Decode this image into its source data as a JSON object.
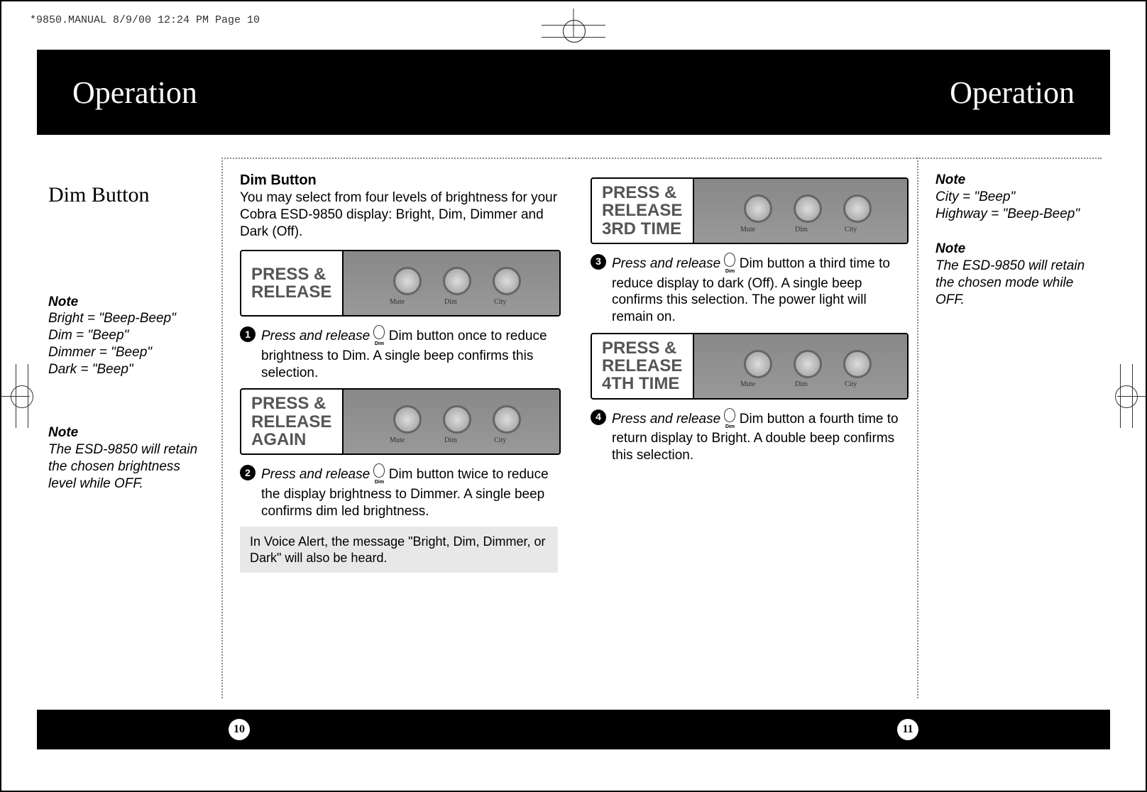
{
  "header_line": "*9850.MANUAL  8/9/00  12:24 PM  Page 10",
  "band_left": "Operation",
  "band_right": "Operation",
  "subtitle": "Dim Button",
  "left_notes": {
    "n1_label": "Note",
    "n1_l1": "Bright = \"Beep-Beep\"",
    "n1_l2": "Dim = \"Beep\"",
    "n1_l3": "Dimmer = \"Beep\"",
    "n1_l4": "Dark = \"Beep\"",
    "n2_label": "Note",
    "n2_body": "The ESD-9850 will retain the chosen brightness level while OFF."
  },
  "main": {
    "heading": "Dim Button",
    "intro": "You may select from four levels of brightness for your Cobra ESD-9850 display:  Bright, Dim, Dimmer and Dark (Off).",
    "fig1": "PRESS & RELEASE",
    "step1_em": "Press and release",
    "step1_rest": "Dim button once to reduce brightness to Dim. A single beep confirms this selection.",
    "fig2": "PRESS & RELEASE AGAIN",
    "step2_em": "Press and release",
    "step2_rest": "Dim button twice to reduce the display brightness to Dimmer. A single beep confirms dim led brightness.",
    "voice_box": "In Voice Alert, the message \"Bright, Dim, Dimmer, or Dark\" will also be heard."
  },
  "main2": {
    "fig3": "PRESS & RELEASE 3RD TIME",
    "step3_em": "Press and release",
    "step3_rest": "Dim button a third time to reduce display to dark (Off). A single beep confirms this selection. The power light will remain on.",
    "fig4": "PRESS & RELEASE 4TH TIME",
    "step4_em": "Press and release",
    "step4_rest": "Dim button a fourth time to return display to Bright.  A double beep confirms this selection."
  },
  "right_notes": {
    "n1_label": "Note",
    "n1_l1": "City = \"Beep\"",
    "n1_l2": "Highway = \"Beep-Beep\"",
    "n2_label": "Note",
    "n2_body": "The ESD-9850 will retain the chosen mode while OFF."
  },
  "device": {
    "b1": "Mute",
    "b2": "Dim",
    "b3": "City"
  },
  "page_left": "10",
  "page_right": "11"
}
